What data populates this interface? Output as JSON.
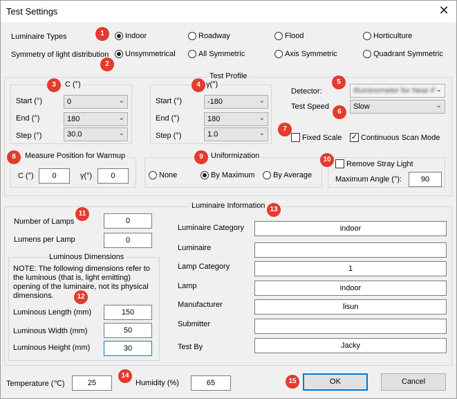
{
  "window": {
    "title": "Test Settings"
  },
  "luminaire_types": {
    "label": "Luminaire Types",
    "options": [
      "Indoor",
      "Roadway",
      "Flood",
      "Horticulture"
    ],
    "selected": "Indoor"
  },
  "symmetry": {
    "label": "Symmetry of light distribution",
    "options": [
      "Unsymmetrical",
      "All Symmetric",
      "Axis Symmetric",
      "Quadrant Symmetric"
    ],
    "selected": "Unsymmetrical"
  },
  "test_profile": {
    "title": "Test Profile",
    "c_group": {
      "title": "C (°)",
      "start_label": "Start (°)",
      "start": "0",
      "end_label": "End (°)",
      "end": "180",
      "step_label": "Step (°)",
      "step": "30.0"
    },
    "y_group": {
      "title": "γ(°)",
      "start_label": "Start (°)",
      "start": "-180",
      "end_label": "End (°)",
      "end": "180",
      "step_label": "Step (°)",
      "step": "1.0"
    },
    "detector_label": "Detector:",
    "detector_value": "Illuminometer for Near-F",
    "test_speed_label": "Test Speed",
    "test_speed_value": "Slow",
    "fixed_scale_label": "Fixed Scale",
    "fixed_scale_checked": false,
    "continuous_scan_label": "Continuous Scan Mode",
    "continuous_scan_checked": true
  },
  "warmup": {
    "title": "Measure Position for Warmup",
    "c_label": "C (°)",
    "c_value": "0",
    "y_label": "γ(°)",
    "y_value": "0"
  },
  "uniformization": {
    "title": "Uniformization",
    "options": [
      "None",
      "By Maximum",
      "By Average"
    ],
    "selected": "By Maximum"
  },
  "stray_light": {
    "label": "Remove Stray Light",
    "checked": false,
    "max_angle_label": "Maximum Angle (°):",
    "max_angle_value": "90"
  },
  "luminaire_info": {
    "title": "Luminaire Information",
    "number_of_lamps_label": "Number of Lamps",
    "number_of_lamps": "0",
    "lumens_per_lamp_label": "Lumens per Lamp",
    "lumens_per_lamp": "0",
    "dimensions_title": "Luminous Dimensions",
    "dimensions_note": "NOTE: The following dimensions refer to the luminous (that is, light emitting) opening of the luminaire, not its physical dimensions.",
    "length_label": "Luminous Length (mm)",
    "length": "150",
    "width_label": "Luminous Width (mm)",
    "width": "50",
    "height_label": "Luminous Height (mm)",
    "height": "30",
    "fields": [
      {
        "label": "Luminaire Category",
        "value": "indoor"
      },
      {
        "label": "Luminaire",
        "value": ""
      },
      {
        "label": "Lamp Category",
        "value": "1"
      },
      {
        "label": "Lamp",
        "value": "indoor"
      },
      {
        "label": "Manufacturer",
        "value": "lisun"
      },
      {
        "label": "Submitter",
        "value": ""
      },
      {
        "label": "Test By",
        "value": "Jacky"
      }
    ]
  },
  "footer": {
    "temperature_label": "Temperature (℃)",
    "temperature": "25",
    "humidity_label": "Humidity (%)",
    "humidity": "65",
    "ok_label": "OK",
    "cancel_label": "Cancel"
  },
  "badges": [
    "1",
    "2",
    "3",
    "4",
    "5",
    "6",
    "7",
    "8",
    "9",
    "10",
    "11",
    "12",
    "13",
    "14",
    "15"
  ],
  "colors": {
    "badge": "#e33b2e",
    "focus_border": "#0078d7"
  }
}
